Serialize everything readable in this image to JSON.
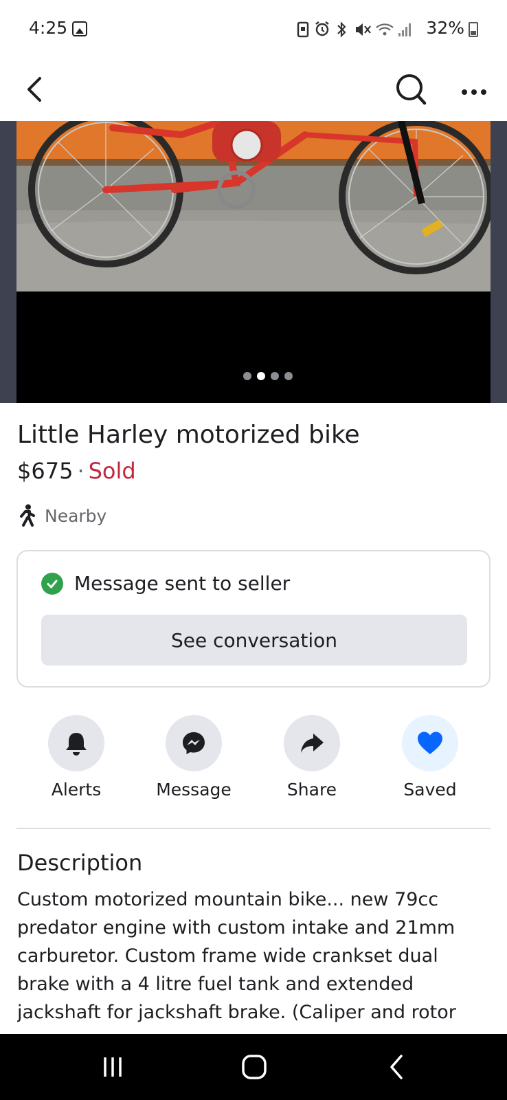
{
  "status_bar": {
    "time": "4:25",
    "battery": "32%",
    "icons": [
      "gallery-icon",
      "sd-card-icon",
      "alarm-icon",
      "bluetooth-icon",
      "mute-icon",
      "wifi-icon",
      "signal-icon",
      "battery-icon"
    ]
  },
  "app_bar": {
    "icons": [
      "back-icon",
      "search-icon",
      "more-icon"
    ]
  },
  "photo": {
    "pages": 4,
    "active_page": 2
  },
  "listing": {
    "title": "Little Harley motorized bike",
    "price": "$675",
    "separator": "·",
    "status": "Sold",
    "status_color": "#c4263c",
    "location": "Nearby"
  },
  "message_card": {
    "status_text": "Message sent to seller",
    "button_label": "See conversation"
  },
  "actions": [
    {
      "label": "Alerts",
      "icon": "bell-icon"
    },
    {
      "label": "Message",
      "icon": "messenger-icon"
    },
    {
      "label": "Share",
      "icon": "share-icon"
    },
    {
      "label": "Saved",
      "icon": "heart-icon",
      "accent": "#0866ff"
    }
  ],
  "description": {
    "heading": "Description",
    "body": "Custom motorized mountain bike... new 79cc predator engine with custom intake and 21mm carburetor. Custom frame wide crankset dual brake with a 4 litre fuel tank and extended jackshaft for jackshaft brake. (Caliper and rotor"
  },
  "nav_bar": {
    "icons": [
      "recents-icon",
      "home-icon",
      "back-nav-icon"
    ]
  }
}
